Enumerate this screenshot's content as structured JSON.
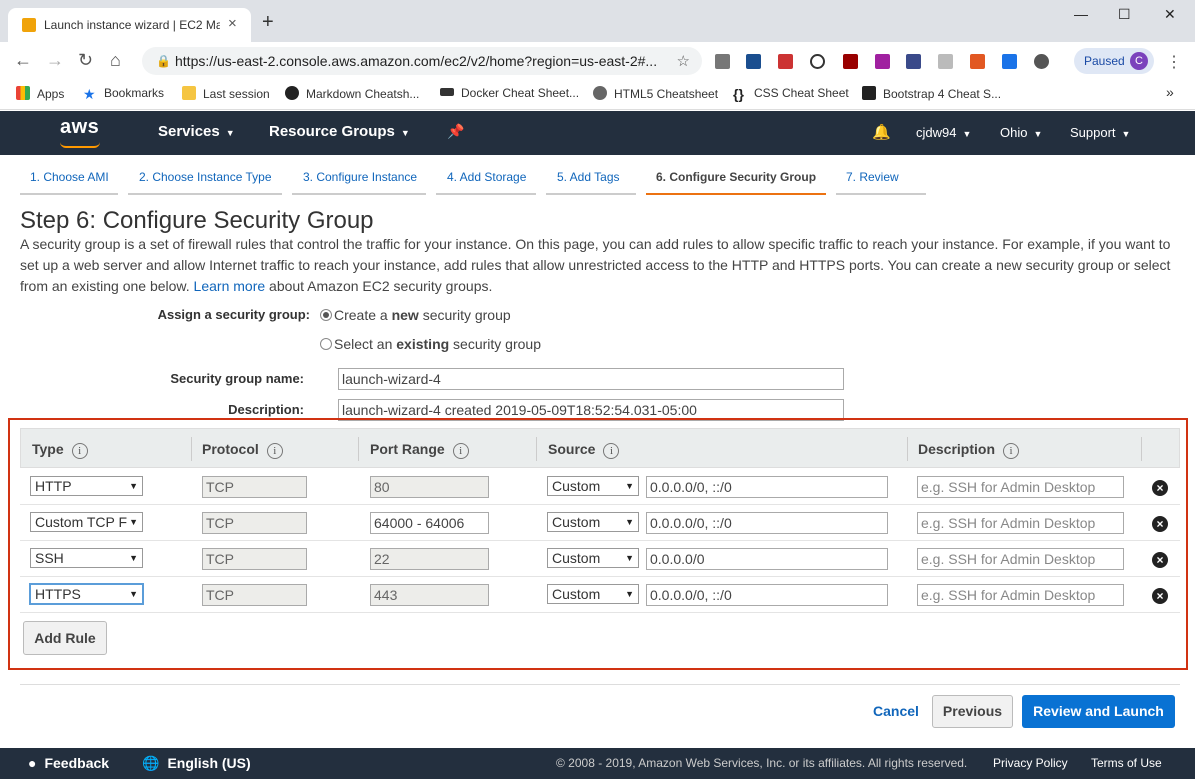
{
  "browser": {
    "tab_title": "Launch instance wizard | EC2 Ma",
    "tab_close": "×",
    "new_tab": "+",
    "url": "https://us-east-2.console.aws.amazon.com/ec2/v2/home?region=us-east-2#...",
    "paused_label": "Paused",
    "avatar_letter": "C",
    "bookmarks": [
      "Apps",
      "Bookmarks",
      "Last session",
      "Markdown Cheatsh...",
      "Docker Cheat Sheet...",
      "HTML5 Cheatsheet",
      "CSS Cheat Sheet",
      "Bootstrap 4 Cheat S..."
    ],
    "bookmarks_more": "»"
  },
  "aws_nav": {
    "logo": "aws",
    "services": "Services",
    "resource_groups": "Resource Groups",
    "user": "cjdw94",
    "region": "Ohio",
    "support": "Support"
  },
  "wizard": {
    "tabs": [
      "1. Choose AMI",
      "2. Choose Instance Type",
      "3. Configure Instance",
      "4. Add Storage",
      "5. Add Tags",
      "6. Configure Security Group",
      "7. Review"
    ],
    "active_tab": 5,
    "title": "Step 6: Configure Security Group",
    "intro_text": "A security group is a set of firewall rules that control the traffic for your instance. On this page, you can add rules to allow specific traffic to reach your instance. For example, if you want to set up a web server and allow Internet traffic to reach your instance, add rules that allow unrestricted access to the HTTP and HTTPS ports. You can create a new security group or select from an existing one below.",
    "learn_more": "Learn more",
    "intro_tail": "about Amazon EC2 security groups."
  },
  "form": {
    "assign_label": "Assign a security group:",
    "option_new_pre": "Create a ",
    "option_new_bold": "new",
    "option_new_post": " security group",
    "option_existing_pre": "Select an ",
    "option_existing_bold": "existing",
    "option_existing_post": " security group",
    "selected_option": "new",
    "name_label": "Security group name:",
    "name_value": "launch-wizard-4",
    "desc_label": "Description:",
    "desc_value": "launch-wizard-4 created 2019-05-09T18:52:54.031-05:00"
  },
  "rules": {
    "headers": [
      "Type",
      "Protocol",
      "Port Range",
      "Source",
      "Description"
    ],
    "rows": [
      {
        "type": "HTTP",
        "protocol": "TCP",
        "port": "80",
        "source_mode": "Custom",
        "source": "0.0.0.0/0, ::/0",
        "description_placeholder": "e.g. SSH for Admin Desktop"
      },
      {
        "type": "Custom TCP F",
        "protocol": "TCP",
        "port": "64000 - 64006",
        "source_mode": "Custom",
        "source": "0.0.0.0/0, ::/0",
        "description_placeholder": "e.g. SSH for Admin Desktop"
      },
      {
        "type": "SSH",
        "protocol": "TCP",
        "port": "22",
        "source_mode": "Custom",
        "source": "0.0.0.0/0",
        "description_placeholder": "e.g. SSH for Admin Desktop"
      },
      {
        "type": "HTTPS",
        "protocol": "TCP",
        "port": "443",
        "source_mode": "Custom",
        "source": "0.0.0.0/0, ::/0",
        "description_placeholder": "e.g. SSH for Admin Desktop"
      }
    ],
    "add_rule": "Add Rule"
  },
  "actions": {
    "cancel": "Cancel",
    "previous": "Previous",
    "review_launch": "Review and Launch"
  },
  "footer": {
    "feedback": "Feedback",
    "language": "English (US)",
    "copyright": "© 2008 - 2019, Amazon Web Services, Inc. or its affiliates. All rights reserved.",
    "privacy": "Privacy Policy",
    "terms": "Terms of Use"
  },
  "colors": {
    "aws_nav_bg": "#232f3e",
    "primary_button": "#0972d3",
    "highlight_border": "#d13212",
    "active_tab_underline": "#ec7211",
    "link": "#1166bb"
  }
}
